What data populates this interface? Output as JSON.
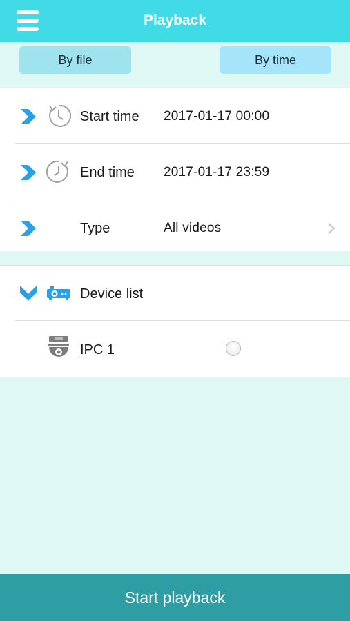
{
  "header": {
    "title": "Playback",
    "menu_icon": "hamburger-menu-icon"
  },
  "mode_tabs": {
    "by_file_label": "By file",
    "by_time_label": "By time"
  },
  "query": {
    "start_time": {
      "label": "Start time",
      "value": "2017-01-17 00:00",
      "icon": "clock-icon"
    },
    "end_time": {
      "label": "End time",
      "value": "2017-01-17 23:59",
      "icon": "clock-icon"
    },
    "type": {
      "label": "Type",
      "value": "All videos"
    }
  },
  "devices": {
    "header_label": "Device list",
    "header_icon": "projector-icon",
    "items": [
      {
        "name": "IPC 1",
        "icon": "dome-camera-icon",
        "selected": false
      }
    ]
  },
  "footer": {
    "start_label": "Start playback"
  },
  "colors": {
    "header": "#41dbe8",
    "background": "#e0f8f3",
    "accent": "#2aa0e6",
    "footer": "#2e9ea4"
  }
}
